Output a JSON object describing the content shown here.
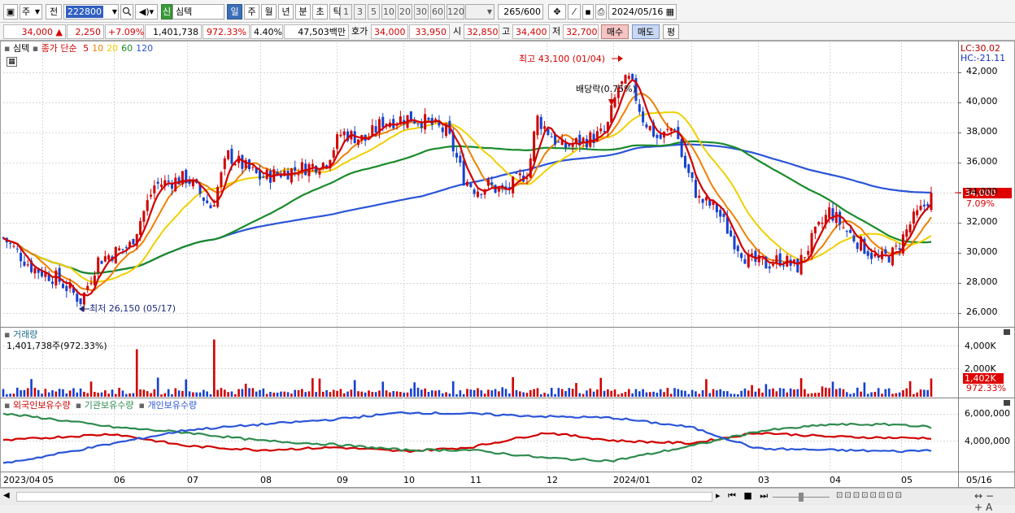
{
  "toolbar": {
    "type_label": "주",
    "jeon_label": "전",
    "code": "222800",
    "stock_badge": "신",
    "stock_name": "심텍",
    "periods": [
      "일",
      "주",
      "월",
      "년",
      "분",
      "초",
      "틱"
    ],
    "active_period": "일",
    "intervals": [
      "1",
      "3",
      "5",
      "10",
      "20",
      "30",
      "60",
      "120"
    ],
    "bars_count": "265",
    "bars_total": "/600",
    "date": "2024/05/16"
  },
  "quote": {
    "price": "34,000",
    "change": "2,250",
    "change_pct": "+7.09%",
    "volume": "1,401,738",
    "volume_ratio": "972.33%",
    "turnover": "4.40%",
    "amount": "47,503백만",
    "hoga_label": "호가",
    "ask": "34,000",
    "bid": "33,950",
    "open_label": "시",
    "open": "32,850",
    "high_label": "고",
    "high": "34,400",
    "low_label": "저",
    "low": "32,700",
    "buy_label": "매수",
    "sell_label": "매도",
    "eval_label": "평"
  },
  "price_panel": {
    "title": "심텍",
    "ma_label": "종가 단순",
    "ma_periods": [
      {
        "p": "5",
        "color": "#d00000"
      },
      {
        "p": "10",
        "color": "#f08000"
      },
      {
        "p": "20",
        "color": "#f0d000"
      },
      {
        "p": "60",
        "color": "#1a8a2a"
      },
      {
        "p": "120",
        "color": "#2a55d8"
      }
    ],
    "lc": "LC:30.02",
    "hc": "HC:-21.11",
    "high_note": "최고 43,100 (01/04)",
    "low_note": "최저 26,150 (05/17)",
    "dividend_note": "배당락(0.75%)",
    "current_price": "34,000",
    "current_pct": "7.09%",
    "y_ticks": [
      "42,000",
      "40,000",
      "38,000",
      "36,000",
      "34,000",
      "32,000",
      "30,000",
      "28,000",
      "26,000"
    ]
  },
  "volume_panel": {
    "title": "거래량",
    "value": "1,401,738주(972.33%)",
    "y_ticks": [
      "4,000K",
      "2,000K"
    ],
    "current": "1,402K",
    "current_pct": "972.33%"
  },
  "holding_panel": {
    "series": [
      {
        "name": "외국인보유수량",
        "color": "#d00000"
      },
      {
        "name": "기관보유수량",
        "color": "#2e8b4e"
      },
      {
        "name": "개인보유수량",
        "color": "#2a55d8"
      }
    ],
    "y_ticks": [
      "6,000,000",
      "4,000,000"
    ]
  },
  "x_axis": {
    "labels": [
      "2023/04",
      "05",
      "06",
      "07",
      "08",
      "09",
      "10",
      "11",
      "12",
      "2024/01",
      "02",
      "03",
      "04",
      "05",
      "05/16"
    ]
  },
  "colors": {
    "up": "#d00000",
    "down": "#1540d0",
    "grid": "#d8d8d8"
  },
  "chart_data": {
    "type": "line",
    "title": "심텍",
    "series": [
      {
        "name": "종가",
        "x": [
          "2023/04",
          "05",
          "06",
          "07",
          "08",
          "09",
          "10",
          "11",
          "12",
          "2024/01",
          "02",
          "03",
          "04",
          "05",
          "05/16"
        ],
        "values": [
          31000,
          27500,
          30500,
          34500,
          35500,
          37500,
          39000,
          34500,
          36500,
          41500,
          36500,
          29500,
          32500,
          30000,
          34000
        ]
      },
      {
        "name": "외국인보유수량",
        "values": [
          4000000,
          4200000,
          4500000,
          3600000,
          3300000,
          3500000,
          3200000,
          3500000,
          4600000,
          4000000,
          3800000,
          4600000,
          4300000,
          4200000,
          4200000
        ]
      },
      {
        "name": "기관보유수량",
        "values": [
          6000000,
          5700000,
          5000000,
          4600000,
          4000000,
          3700000,
          3300000,
          3300000,
          2700000,
          2500000,
          3600000,
          4700000,
          5200000,
          5200000,
          5000000
        ]
      },
      {
        "name": "개인보유수량",
        "values": [
          2300000,
          2800000,
          3800000,
          4800000,
          5200000,
          5600000,
          6100000,
          6000000,
          5800000,
          5700000,
          5000000,
          3400000,
          3300000,
          3200000,
          3300000
        ]
      }
    ],
    "ylim": [
      25000,
      43500
    ]
  }
}
